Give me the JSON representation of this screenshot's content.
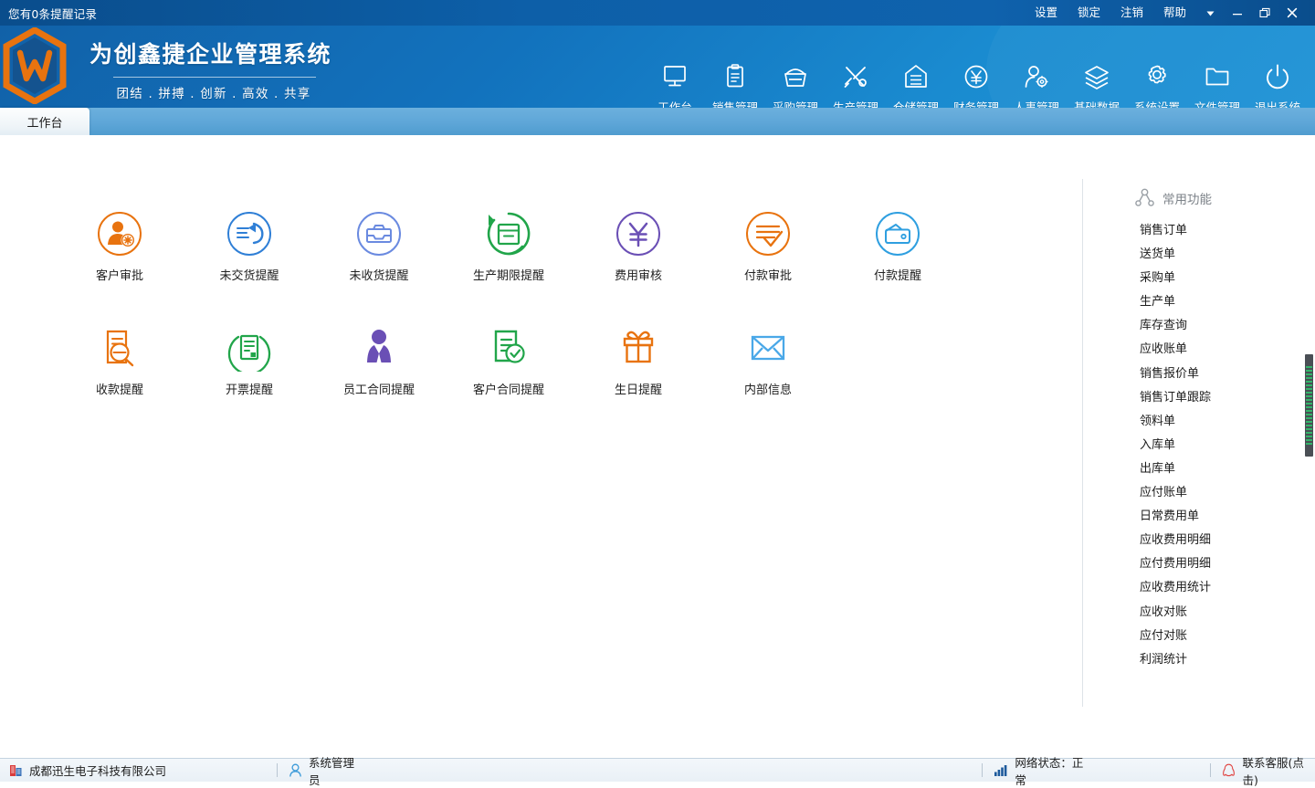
{
  "titlebar": {
    "notice": "您有0条提醒记录",
    "menus": [
      "设置",
      "锁定",
      "注销",
      "帮助"
    ],
    "icons": {
      "dropdown": "caret-down-icon",
      "minimize": "minimize-icon",
      "restore": "restore-icon",
      "close": "close-icon"
    }
  },
  "header": {
    "logo_letter": "W",
    "title": "为创鑫捷企业管理系统",
    "slogan": "团结 . 拼搏 . 创新 . 高效 . 共享",
    "nav": [
      {
        "label": "工作台",
        "icon": "monitor-icon"
      },
      {
        "label": "销售管理",
        "icon": "clipboard-icon"
      },
      {
        "label": "采购管理",
        "icon": "basket-icon"
      },
      {
        "label": "生产管理",
        "icon": "tools-icon"
      },
      {
        "label": "仓储管理",
        "icon": "warehouse-icon"
      },
      {
        "label": "财务管理",
        "icon": "yuan-circle-icon"
      },
      {
        "label": "人事管理",
        "icon": "user-gear-icon"
      },
      {
        "label": "基础数据",
        "icon": "layers-icon"
      },
      {
        "label": "系统设置",
        "icon": "gear-icon"
      },
      {
        "label": "文件管理",
        "icon": "folder-icon"
      },
      {
        "label": "退出系统",
        "icon": "power-icon"
      }
    ]
  },
  "tabs": [
    {
      "label": "工作台",
      "active": true
    }
  ],
  "shortcuts": {
    "row1": [
      {
        "label": "客户审批",
        "icon": "user-approve-icon",
        "color": "#e8730f"
      },
      {
        "label": "未交货提醒",
        "icon": "delivery-back-icon",
        "color": "#2f7fd6"
      },
      {
        "label": "未收货提醒",
        "icon": "inbox-icon",
        "color": "#6a8ae0"
      },
      {
        "label": "生产期限提醒",
        "icon": "production-cycle-icon",
        "color": "#21a54a"
      },
      {
        "label": "费用审核",
        "icon": "yuan-circle-icon",
        "color": "#6a4fb5"
      },
      {
        "label": "付款审批",
        "icon": "doc-check-icon",
        "color": "#e8730f"
      },
      {
        "label": "付款提醒",
        "icon": "wallet-icon",
        "color": "#2f9fe0"
      }
    ],
    "row2": [
      {
        "label": "收款提醒",
        "icon": "doc-search-icon",
        "color": "#e8730f"
      },
      {
        "label": "开票提醒",
        "icon": "invoice-circle-icon",
        "color": "#21a54a"
      },
      {
        "label": "员工合同提醒",
        "icon": "employee-icon",
        "color": "#6a4fb5"
      },
      {
        "label": "客户合同提醒",
        "icon": "doc-approved-icon",
        "color": "#21a54a"
      },
      {
        "label": "生日提醒",
        "icon": "gift-icon",
        "color": "#e8730f"
      },
      {
        "label": "内部信息",
        "icon": "envelope-icon",
        "color": "#4aa8e8"
      }
    ]
  },
  "right_panel": {
    "title": "常用功能",
    "title_icon": "share-node-icon",
    "items": [
      "销售订单",
      "送货单",
      "采购单",
      "生产单",
      "库存查询",
      "应收账单",
      "销售报价单",
      "销售订单跟踪",
      "领料单",
      "入库单",
      "出库单",
      "应付账单",
      "日常费用单",
      "应收费用明细",
      "应付费用明细",
      "应收费用统计",
      "应收对账",
      "应付对账",
      "利润统计"
    ]
  },
  "statusbar": {
    "company": "成都迅生电子科技有限公司",
    "company_icon": "building-icon",
    "user": "系统管理员",
    "user_icon": "user-icon",
    "network": "网络状态：正常",
    "network_icon": "signal-bars-icon",
    "support": "联系客服(点击)",
    "support_icon": "qq-penguin-icon"
  },
  "theme": {
    "titlebar_blue": "#0d5fa8",
    "header_blue": "#1272bd",
    "logo_orange": "#e8730f",
    "tab_blue": "#5ea6d8",
    "scroll_green": "#33b46a"
  }
}
